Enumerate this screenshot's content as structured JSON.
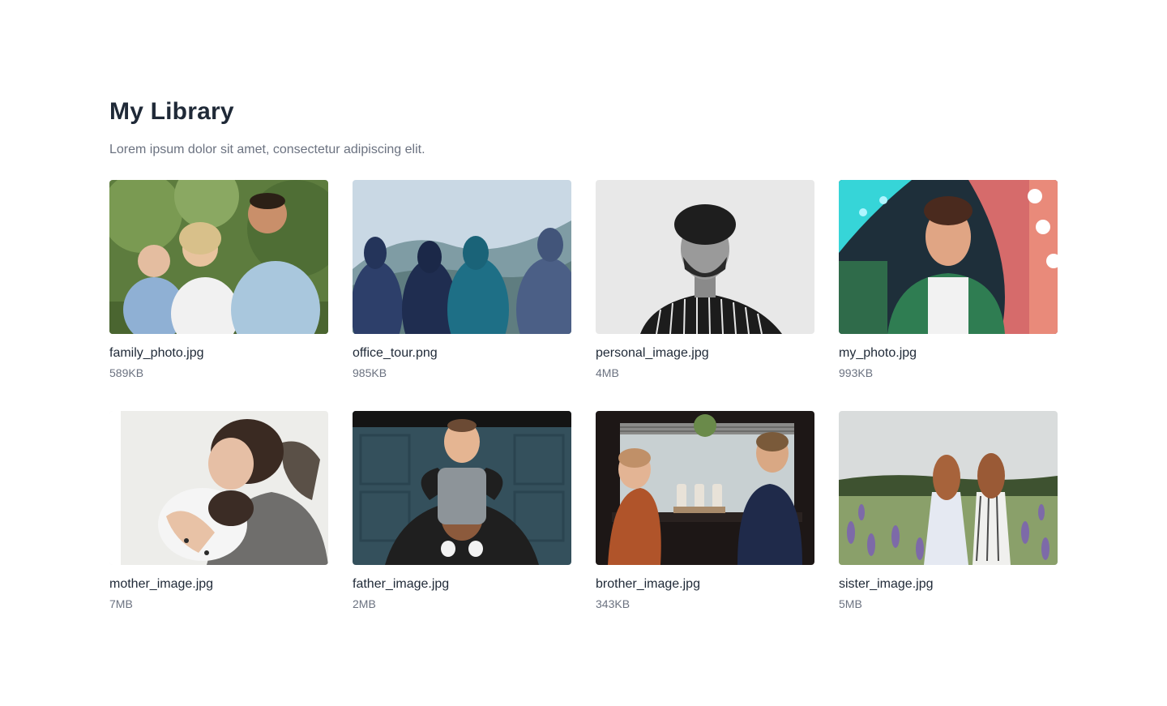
{
  "library": {
    "title": "My Library",
    "subtitle": "Lorem ipsum dolor sit amet, consectetur adipiscing elit."
  },
  "files": [
    {
      "name": "family_photo.jpg",
      "size": "589KB"
    },
    {
      "name": "office_tour.png",
      "size": "985KB"
    },
    {
      "name": "personal_image.jpg",
      "size": "4MB"
    },
    {
      "name": "my_photo.jpg",
      "size": "993KB"
    },
    {
      "name": "mother_image.jpg",
      "size": "7MB"
    },
    {
      "name": "father_image.jpg",
      "size": "2MB"
    },
    {
      "name": "brother_image.jpg",
      "size": "343KB"
    },
    {
      "name": "sister_image.jpg",
      "size": "5MB"
    }
  ]
}
